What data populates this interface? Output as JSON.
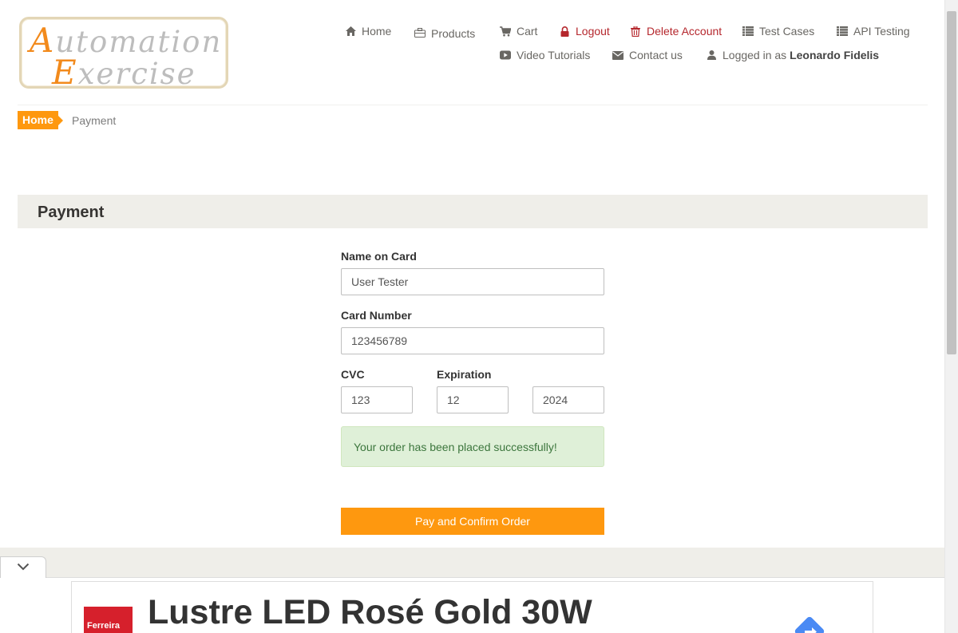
{
  "logo": {
    "line1_cap": "A",
    "line1_rest": "utomation",
    "line2_cap": "E",
    "line2_rest": "xercise"
  },
  "nav": {
    "home": "Home",
    "products": "Products",
    "cart": "Cart",
    "logout": "Logout",
    "delete_account": "Delete Account",
    "test_cases": "Test Cases",
    "api_testing": "API Testing",
    "video_tutorials": "Video Tutorials",
    "contact_us": "Contact us",
    "logged_in_prefix": "Logged in as",
    "logged_in_user": "Leonardo Fidelis"
  },
  "breadcrumb": {
    "home": "Home",
    "current": "Payment"
  },
  "payment": {
    "title": "Payment",
    "name_label": "Name on Card",
    "name_value": "User Tester",
    "card_label": "Card Number",
    "card_value": "123456789",
    "cvc_label": "CVC",
    "cvc_value": "123",
    "expiration_label": "Expiration",
    "exp_month": "12",
    "exp_year": "2024",
    "success_message": "Your order has been placed successfully!",
    "pay_button": "Pay and Confirm Order"
  },
  "ad": {
    "title": "Lustre LED Rosé Gold 30W",
    "brand": "Ferreira"
  },
  "colors": {
    "accent": "#fe980f",
    "danger": "#b5272d",
    "success_bg": "#dff0d8",
    "success_text": "#3c763d",
    "logo_orange": "#f28a1c"
  },
  "icons": [
    "home-icon",
    "briefcase-icon",
    "cart-icon",
    "lock-icon",
    "trash-icon",
    "list-icon",
    "video-icon",
    "envelope-icon",
    "user-icon",
    "chevron-down-icon"
  ]
}
